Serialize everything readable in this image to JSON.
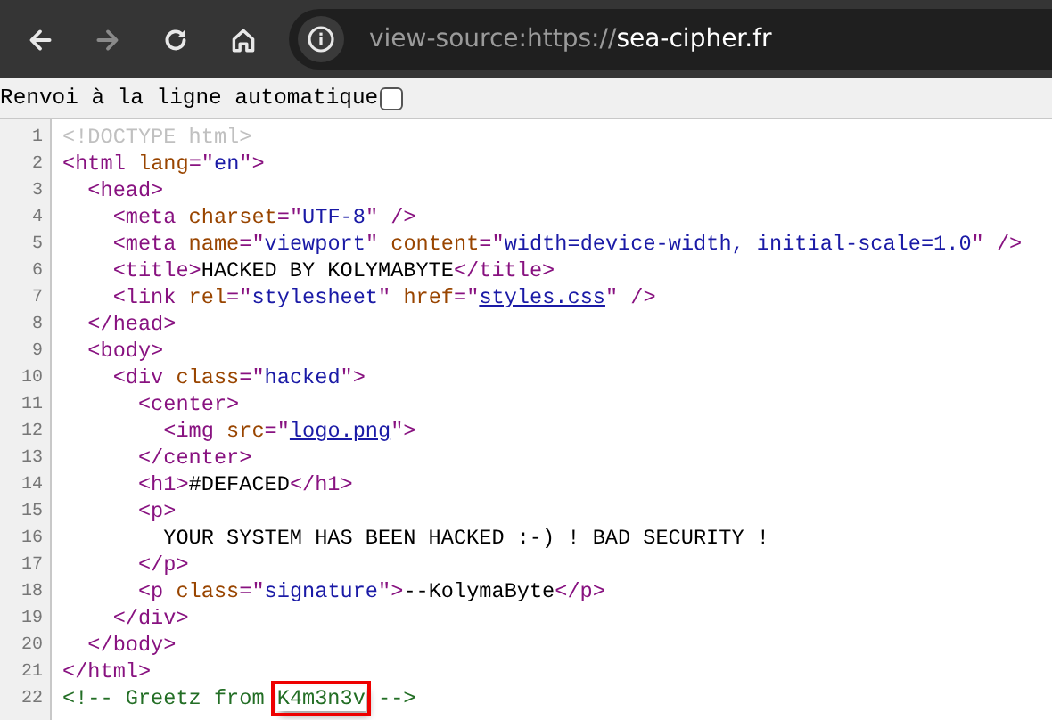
{
  "toolbar": {
    "buttons": [
      {
        "kind": "back",
        "disabled": false
      },
      {
        "kind": "forward",
        "disabled": true
      },
      {
        "kind": "reload",
        "disabled": false
      },
      {
        "kind": "home",
        "disabled": false
      }
    ],
    "address": {
      "scheme": "view-source:https://",
      "host": "sea-cipher.fr"
    }
  },
  "wrap_option": {
    "label": "Renvoi à la ligne automatique",
    "checked": false
  },
  "lines": [
    {
      "number": "1",
      "segments": [
        {
          "kind": "doctype",
          "text": "<!DOCTYPE html>"
        }
      ]
    },
    {
      "number": "2",
      "segments": [
        {
          "kind": "tag",
          "text": "<html "
        },
        {
          "kind": "attr",
          "text": "lang"
        },
        {
          "kind": "tag",
          "text": "=\""
        },
        {
          "kind": "value",
          "text": "en"
        },
        {
          "kind": "tag",
          "text": "\">"
        }
      ]
    },
    {
      "number": "3",
      "segments": [
        {
          "kind": "tag",
          "text": "  <head>"
        }
      ]
    },
    {
      "number": "4",
      "segments": [
        {
          "kind": "tag",
          "text": "    <meta "
        },
        {
          "kind": "attr",
          "text": "charset"
        },
        {
          "kind": "tag",
          "text": "=\""
        },
        {
          "kind": "value",
          "text": "UTF-8"
        },
        {
          "kind": "tag",
          "text": "\" />"
        }
      ]
    },
    {
      "number": "5",
      "segments": [
        {
          "kind": "tag",
          "text": "    <meta "
        },
        {
          "kind": "attr",
          "text": "name"
        },
        {
          "kind": "tag",
          "text": "=\""
        },
        {
          "kind": "value",
          "text": "viewport"
        },
        {
          "kind": "tag",
          "text": "\" "
        },
        {
          "kind": "attr",
          "text": "content"
        },
        {
          "kind": "tag",
          "text": "=\""
        },
        {
          "kind": "value",
          "text": "width=device-width, initial-scale=1.0"
        },
        {
          "kind": "tag",
          "text": "\" />"
        }
      ]
    },
    {
      "number": "6",
      "segments": [
        {
          "kind": "tag",
          "text": "    <title>"
        },
        {
          "kind": "text",
          "text": "HACKED BY KOLYMABYTE"
        },
        {
          "kind": "tag",
          "text": "</title>"
        }
      ]
    },
    {
      "number": "7",
      "segments": [
        {
          "kind": "tag",
          "text": "    <link "
        },
        {
          "kind": "attr",
          "text": "rel"
        },
        {
          "kind": "tag",
          "text": "=\""
        },
        {
          "kind": "value",
          "text": "stylesheet"
        },
        {
          "kind": "tag",
          "text": "\" "
        },
        {
          "kind": "attr",
          "text": "href"
        },
        {
          "kind": "tag",
          "text": "=\""
        },
        {
          "kind": "link",
          "text": "styles.css"
        },
        {
          "kind": "tag",
          "text": "\" />"
        }
      ]
    },
    {
      "number": "8",
      "segments": [
        {
          "kind": "tag",
          "text": "  </head>"
        }
      ]
    },
    {
      "number": "9",
      "segments": [
        {
          "kind": "tag",
          "text": "  <body>"
        }
      ]
    },
    {
      "number": "10",
      "segments": [
        {
          "kind": "tag",
          "text": "    <div "
        },
        {
          "kind": "attr",
          "text": "class"
        },
        {
          "kind": "tag",
          "text": "=\""
        },
        {
          "kind": "value",
          "text": "hacked"
        },
        {
          "kind": "tag",
          "text": "\">"
        }
      ]
    },
    {
      "number": "11",
      "segments": [
        {
          "kind": "tag",
          "text": "      <center>"
        }
      ]
    },
    {
      "number": "12",
      "segments": [
        {
          "kind": "tag",
          "text": "        <img "
        },
        {
          "kind": "attr",
          "text": "src"
        },
        {
          "kind": "tag",
          "text": "=\""
        },
        {
          "kind": "link",
          "text": "logo.png"
        },
        {
          "kind": "tag",
          "text": "\">"
        }
      ]
    },
    {
      "number": "13",
      "segments": [
        {
          "kind": "tag",
          "text": "      </center>"
        }
      ]
    },
    {
      "number": "14",
      "segments": [
        {
          "kind": "tag",
          "text": "      <h1>"
        },
        {
          "kind": "text",
          "text": "#DEFACED"
        },
        {
          "kind": "tag",
          "text": "</h1>"
        }
      ]
    },
    {
      "number": "15",
      "segments": [
        {
          "kind": "tag",
          "text": "      <p>"
        }
      ]
    },
    {
      "number": "16",
      "segments": [
        {
          "kind": "text",
          "text": "        YOUR SYSTEM HAS BEEN HACKED :-) ! BAD SECURITY !"
        }
      ]
    },
    {
      "number": "17",
      "segments": [
        {
          "kind": "tag",
          "text": "      </p>"
        }
      ]
    },
    {
      "number": "18",
      "segments": [
        {
          "kind": "tag",
          "text": "      <p "
        },
        {
          "kind": "attr",
          "text": "class"
        },
        {
          "kind": "tag",
          "text": "=\""
        },
        {
          "kind": "value",
          "text": "signature"
        },
        {
          "kind": "tag",
          "text": "\">"
        },
        {
          "kind": "text",
          "text": "--KolymaByte"
        },
        {
          "kind": "tag",
          "text": "</p>"
        }
      ]
    },
    {
      "number": "19",
      "segments": [
        {
          "kind": "tag",
          "text": "    </div>"
        }
      ]
    },
    {
      "number": "20",
      "segments": [
        {
          "kind": "tag",
          "text": "  </body>"
        }
      ]
    },
    {
      "number": "21",
      "segments": [
        {
          "kind": "tag",
          "text": "</html>"
        }
      ]
    },
    {
      "number": "22",
      "segments": [
        {
          "kind": "comment",
          "text": "<!-- Greetz from "
        },
        {
          "kind": "marked",
          "text": "K4m3n3v"
        },
        {
          "kind": "comment",
          "text": " -->"
        }
      ]
    }
  ]
}
